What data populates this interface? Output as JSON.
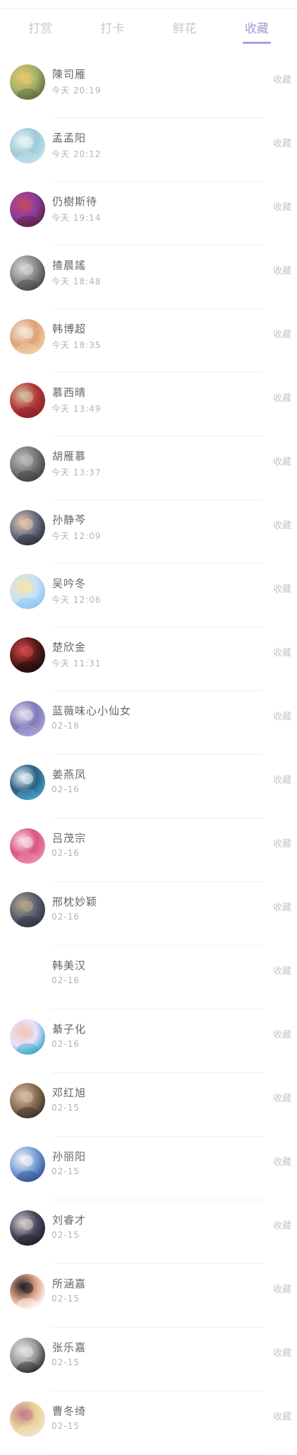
{
  "tabs": [
    {
      "label": "打赏",
      "active": false
    },
    {
      "label": "打卡",
      "active": false
    },
    {
      "label": "鲜花",
      "active": false
    },
    {
      "label": "收藏",
      "active": true
    }
  ],
  "colors": {
    "active_tab": "#a997cf",
    "underline": "#b49be0",
    "inactive_text": "#c8c8c8"
  },
  "entries": [
    {
      "name": "陳司雁",
      "time": "今天 20:19",
      "action": "收藏",
      "avatar": {
        "c1": "#5a6b3a",
        "c2": "#e8c86a",
        "c3": "#a6b16b"
      }
    },
    {
      "name": "孟孟阳",
      "time": "今天 20:12",
      "action": "收藏",
      "avatar": {
        "c1": "#bfe3ee",
        "c2": "#e9f4f6",
        "c3": "#9fc9d6"
      }
    },
    {
      "name": "仍樹斯待",
      "time": "今天 19:14",
      "action": "收藏",
      "avatar": {
        "c1": "#5e1e3a",
        "c2": "#c54866",
        "c3": "#8b3ea0"
      }
    },
    {
      "name": "揸晨謠",
      "time": "今天 18:48",
      "action": "收藏",
      "avatar": {
        "c1": "#444444",
        "c2": "#d8d8d8",
        "c3": "#888888"
      }
    },
    {
      "name": "韩博超",
      "time": "今天 18:35",
      "action": "收藏",
      "avatar": {
        "c1": "#f1d2a4",
        "c2": "#f6e9d8",
        "c3": "#e0a07a"
      }
    },
    {
      "name": "慕西晴",
      "time": "今天 13:49",
      "action": "收藏",
      "avatar": {
        "c1": "#8a1e24",
        "c2": "#d9c3a0",
        "c3": "#b03a3a"
      }
    },
    {
      "name": "胡雁慕",
      "time": "今天 13:37",
      "action": "收藏",
      "avatar": {
        "c1": "#3d3d3d",
        "c2": "#bdbdbd",
        "c3": "#777777"
      }
    },
    {
      "name": "孙静芩",
      "time": "今天 12:09",
      "action": "收藏",
      "avatar": {
        "c1": "#2b2e3a",
        "c2": "#e6c9b0",
        "c3": "#6a6f7e"
      }
    },
    {
      "name": "吴吟冬",
      "time": "今天 12:06",
      "action": "收藏",
      "avatar": {
        "c1": "#8ac4f0",
        "c2": "#f7e6a8",
        "c3": "#c8e2f8"
      }
    },
    {
      "name": "楚欣金",
      "time": "今天 11:31",
      "action": "收藏",
      "avatar": {
        "c1": "#1a0d0d",
        "c2": "#d34a4a",
        "c3": "#5a1a1a"
      }
    },
    {
      "name": "蓝薇味心小仙女",
      "time": "02-16",
      "action": "收藏",
      "avatar": {
        "c1": "#a9a4d6",
        "c2": "#e6e0f3",
        "c3": "#7f7ab8"
      }
    },
    {
      "name": "姜燕凤",
      "time": "02-16",
      "action": "收藏",
      "avatar": {
        "c1": "#4aa0c8",
        "c2": "#e8f4fa",
        "c3": "#2b5f80"
      }
    },
    {
      "name": "吕茂宗",
      "time": "02-16",
      "action": "收藏",
      "avatar": {
        "c1": "#ee8fb0",
        "c2": "#fbe0ea",
        "c3": "#d8567f"
      }
    },
    {
      "name": "邢枕妙颖",
      "time": "02-16",
      "action": "收藏",
      "avatar": {
        "c1": "#2e3340",
        "c2": "#b7a88e",
        "c3": "#59606e"
      }
    },
    {
      "name": "韩美汉",
      "time": "02-16",
      "action": "收藏",
      "avatar": null
    },
    {
      "name": "綦子化",
      "time": "02-16",
      "action": "收藏",
      "avatar": {
        "c1": "#2aa6c6",
        "c2": "#f3c7b4",
        "c3": "#e9e0ff"
      }
    },
    {
      "name": "邓红旭",
      "time": "02-15",
      "action": "收藏",
      "avatar": {
        "c1": "#3a3026",
        "c2": "#d9c2a4",
        "c3": "#8a6f55"
      }
    },
    {
      "name": "孙丽阳",
      "time": "02-15",
      "action": "收藏",
      "avatar": {
        "c1": "#2f4f8f",
        "c2": "#f5f5f5",
        "c3": "#7aa0d8"
      }
    },
    {
      "name": "刘睿才",
      "time": "02-15",
      "action": "收藏",
      "avatar": {
        "c1": "#1f1f2a",
        "c2": "#d7cfcf",
        "c3": "#4a4a60"
      }
    },
    {
      "name": "所涵嘉",
      "time": "02-15",
      "action": "收藏",
      "avatar": {
        "c1": "#ffffff",
        "c2": "#222222",
        "c3": "#e0a38a"
      }
    },
    {
      "name": "张乐嘉",
      "time": "02-15",
      "action": "收藏",
      "avatar": {
        "c1": "#2a2a2a",
        "c2": "#e4e4e4",
        "c3": "#9a9a9a"
      }
    },
    {
      "name": "曹冬绮",
      "time": "02-15",
      "action": "收藏",
      "avatar": {
        "c1": "#f4e2c8",
        "c2": "#c67e8a",
        "c3": "#e9d29a"
      }
    }
  ]
}
